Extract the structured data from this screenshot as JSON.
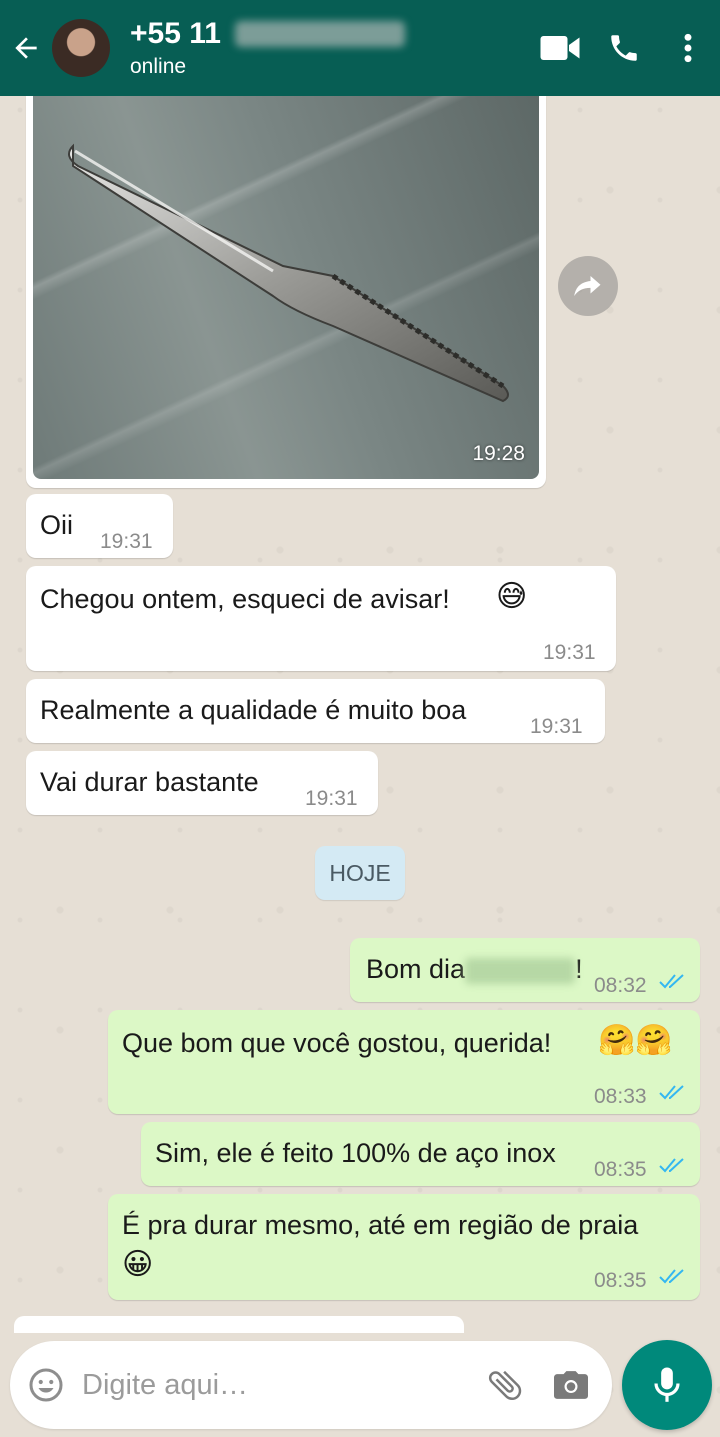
{
  "header": {
    "contact_name": "+55 11",
    "status": "online"
  },
  "messages": {
    "image_time": "19:28",
    "m1": {
      "text": "Oii",
      "time": "19:31"
    },
    "m2": {
      "text": "Chegou ontem, esqueci de avisar!",
      "emoji": "😅",
      "time": "19:31"
    },
    "m3": {
      "text": "Realmente a qualidade é muito boa",
      "time": "19:31"
    },
    "m4": {
      "text": "Vai durar bastante",
      "time": "19:31"
    },
    "date_chip": "HOJE",
    "m5": {
      "text": "Bom dia",
      "suffix": "!",
      "time": "08:32"
    },
    "m6": {
      "text": "Que bom que você gostou, querida!",
      "emoji": "🤗🤗",
      "time": "08:33"
    },
    "m7": {
      "text": "Sim, ele é feito 100% de aço inox",
      "time": "08:35"
    },
    "m8": {
      "text": "É pra durar mesmo, até em região de praia",
      "emoji": "😀",
      "time": "08:35"
    }
  },
  "input": {
    "placeholder": "Digite aqui…"
  },
  "colors": {
    "header": "#075e54",
    "outgoing_bubble": "#dcf8c6",
    "incoming_bubble": "#ffffff",
    "read_ticks": "#34b7f1",
    "mic_button": "#00897b"
  },
  "icons": [
    "back-arrow-icon",
    "video-call-icon",
    "phone-icon",
    "more-vert-icon",
    "forward-icon",
    "emoji-icon",
    "attach-icon",
    "camera-icon",
    "mic-icon",
    "double-check-icon"
  ]
}
